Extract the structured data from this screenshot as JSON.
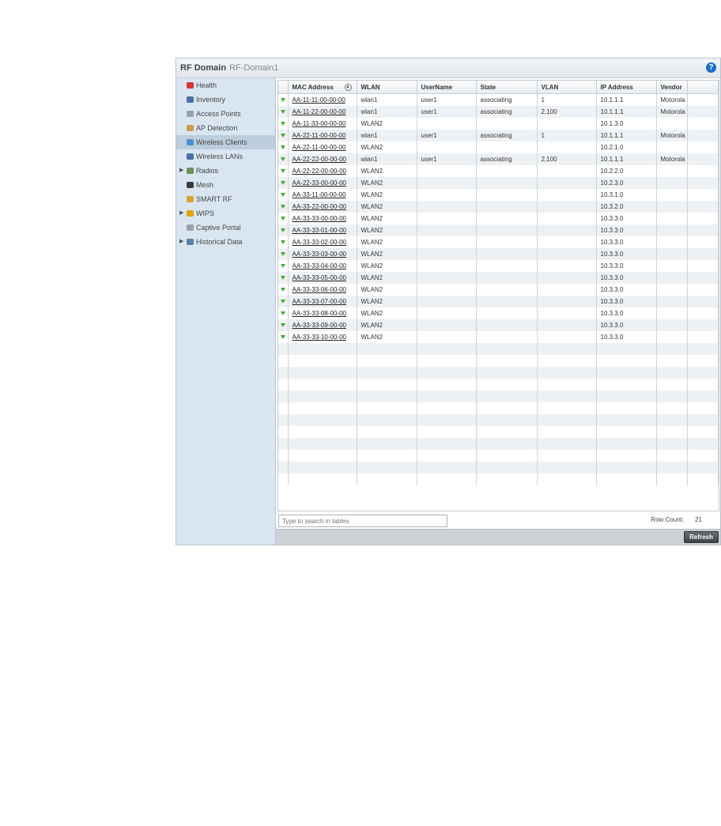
{
  "header": {
    "title": "RF Domain",
    "crumb": "RF-Domain1",
    "help_label": "?"
  },
  "sidebar": {
    "items": [
      {
        "label": "Health",
        "icon": "heart-icon",
        "expandable": false
      },
      {
        "label": "Inventory",
        "icon": "inventory-icon",
        "expandable": false
      },
      {
        "label": "Access Points",
        "icon": "access-point-icon",
        "expandable": false
      },
      {
        "label": "AP Detection",
        "icon": "ap-detection-icon",
        "expandable": false
      },
      {
        "label": "Wireless Clients",
        "icon": "wireless-client-icon",
        "expandable": false,
        "active": true
      },
      {
        "label": "Wireless LANs",
        "icon": "wlan-icon",
        "expandable": false
      },
      {
        "label": "Radios",
        "icon": "radio-icon",
        "expandable": true
      },
      {
        "label": "Mesh",
        "icon": "mesh-icon",
        "expandable": false
      },
      {
        "label": "SMART RF",
        "icon": "smart-rf-icon",
        "expandable": false
      },
      {
        "label": "WIPS",
        "icon": "wips-warning-icon",
        "expandable": true
      },
      {
        "label": "Captive Portal",
        "icon": "captive-portal-icon",
        "expandable": false
      },
      {
        "label": "Historical Data",
        "icon": "historical-data-icon",
        "expandable": true
      }
    ]
  },
  "table": {
    "columns": [
      "MAC Address",
      "WLAN",
      "UserName",
      "State",
      "VLAN",
      "IP Address",
      "Vendor"
    ],
    "sort_icon": "sort-ascending-icon",
    "rows": [
      [
        "AA-11-11-00-00-00",
        "wlan1",
        "user1",
        "associating",
        "1",
        "10.1.1.1",
        "Motorola"
      ],
      [
        "AA-11-22-00-00-00",
        "wlan1",
        "user1",
        "associating",
        "2,100",
        "10.1.1.1",
        "Motorola"
      ],
      [
        "AA-11-33-00-00-00",
        "WLAN2",
        "",
        "",
        "",
        "10.1.3.0",
        ""
      ],
      [
        "AA-22-11-00-00-00",
        "wlan1",
        "user1",
        "associating",
        "1",
        "10.1.1.1",
        "Motorola"
      ],
      [
        "AA-22-11-00-00-00",
        "WLAN2",
        "",
        "",
        "",
        "10.2.1.0",
        ""
      ],
      [
        "AA-22-22-00-00-00",
        "wlan1",
        "user1",
        "associating",
        "2,100",
        "10.1.1.1",
        "Motorola"
      ],
      [
        "AA-22-22-00-00-00",
        "WLAN2",
        "",
        "",
        "",
        "10.2.2.0",
        ""
      ],
      [
        "AA-22-33-00-00-00",
        "WLAN2",
        "",
        "",
        "",
        "10.2.3.0",
        ""
      ],
      [
        "AA-33-11-00-00-00",
        "WLAN2",
        "",
        "",
        "",
        "10.3.1.0",
        ""
      ],
      [
        "AA-33-22-00-00-00",
        "WLAN2",
        "",
        "",
        "",
        "10.3.2.0",
        ""
      ],
      [
        "AA-33-33-00-00-00",
        "WLAN2",
        "",
        "",
        "",
        "10.3.3.0",
        ""
      ],
      [
        "AA-33-33-01-00-00",
        "WLAN2",
        "",
        "",
        "",
        "10.3.3.0",
        ""
      ],
      [
        "AA-33-33-02-00-00",
        "WLAN2",
        "",
        "",
        "",
        "10.3.3.0",
        ""
      ],
      [
        "AA-33-33-03-00-00",
        "WLAN2",
        "",
        "",
        "",
        "10.3.3.0",
        ""
      ],
      [
        "AA-33-33-04-00-00",
        "WLAN2",
        "",
        "",
        "",
        "10.3.3.0",
        ""
      ],
      [
        "AA-33-33-05-00-00",
        "WLAN2",
        "",
        "",
        "",
        "10.3.3.0",
        ""
      ],
      [
        "AA-33-33-06-00-00",
        "WLAN2",
        "",
        "",
        "",
        "10.3.3.0",
        ""
      ],
      [
        "AA-33-33-07-00-00",
        "WLAN2",
        "",
        "",
        "",
        "10.3.3.0",
        ""
      ],
      [
        "AA-33-33-08-00-00",
        "WLAN2",
        "",
        "",
        "",
        "10.3.3.0",
        ""
      ],
      [
        "AA-33-33-09-00-00",
        "WLAN2",
        "",
        "",
        "",
        "10.3.3.0",
        ""
      ],
      [
        "AA-33-33-10-00-00",
        "WLAN2",
        "",
        "",
        "",
        "10.3.3.0",
        ""
      ]
    ],
    "row_icon": "green-arrow-icon"
  },
  "footer": {
    "search_placeholder": "Type to search in tables",
    "row_count_label": "Row Count:",
    "row_count_value": "21",
    "refresh_label": "Refresh"
  },
  "colors": {
    "accent": "#1a6ecf",
    "row_icon": "#3fae2a",
    "sidebar_bg": "#d9e6f1"
  }
}
